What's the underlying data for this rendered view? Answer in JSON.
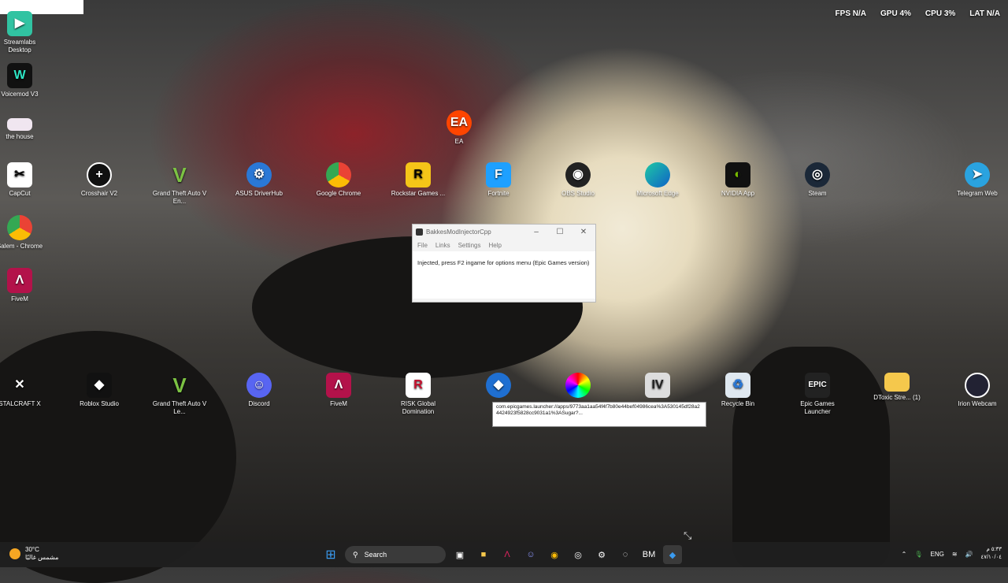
{
  "stats": {
    "fps_label": "FPS",
    "fps_value": "N/A",
    "gpu_label": "GPU",
    "gpu_value": "4%",
    "cpu_label": "CPU",
    "cpu_value": "3%",
    "lat_label": "LAT",
    "lat_value": "N/A"
  },
  "icons": {
    "streamlabs": "Streamlabs Desktop",
    "voicemod": "Voicemod V3",
    "thehouse": "the house",
    "capcut": "CapCut",
    "salem": "Salem - Chrome",
    "fivem_left": "FiveM",
    "stalcraft": "STALCRAFT X",
    "ea": "EA",
    "crosshair": "Crosshair V2",
    "gta1": "Grand Theft Auto V En...",
    "asus": "ASUS DriverHub",
    "chrome": "Google Chrome",
    "rockstar": "Rockstar Games ...",
    "fortnite": "Fortnite",
    "obs": "OBS Studio",
    "edge": "Microsoft Edge",
    "nvidia": "NVIDIA App",
    "steam": "Steam",
    "telegram": "Telegram Web",
    "roblox": "Roblox Studio",
    "gta2": "Grand Theft Auto V Le...",
    "discord": "Discord",
    "fivem2": "FiveM",
    "risk": "RISK Global Domination",
    "recycle": "Recycle Bin",
    "epic": "Epic Games Launcher",
    "dtoxic": "DToxic Stre... (1)",
    "irion": "Irion Webcam"
  },
  "window": {
    "title": "BakkesModInjectorCpp",
    "menu_file": "File",
    "menu_links": "Links",
    "menu_settings": "Settings",
    "menu_help": "Help",
    "message": "Injected, press F2 ingame for options menu (Epic Games version)"
  },
  "tooltip": {
    "text": "com.epicgames.launcher://apps/9773aa1aa54f4f7b80e44bef04986cea%3A530145df28a24424923f5828cc9031a1%3ASugar?..."
  },
  "taskbar": {
    "temp": "30°C",
    "condition": "مشمس غالبًا",
    "search": "Search",
    "lang": "ENG",
    "time": "٥:٣٣ م",
    "date": "٤٧/١٠/٠٤"
  },
  "colors": {
    "accent": "#0078d4",
    "taskbar": "#202020"
  }
}
